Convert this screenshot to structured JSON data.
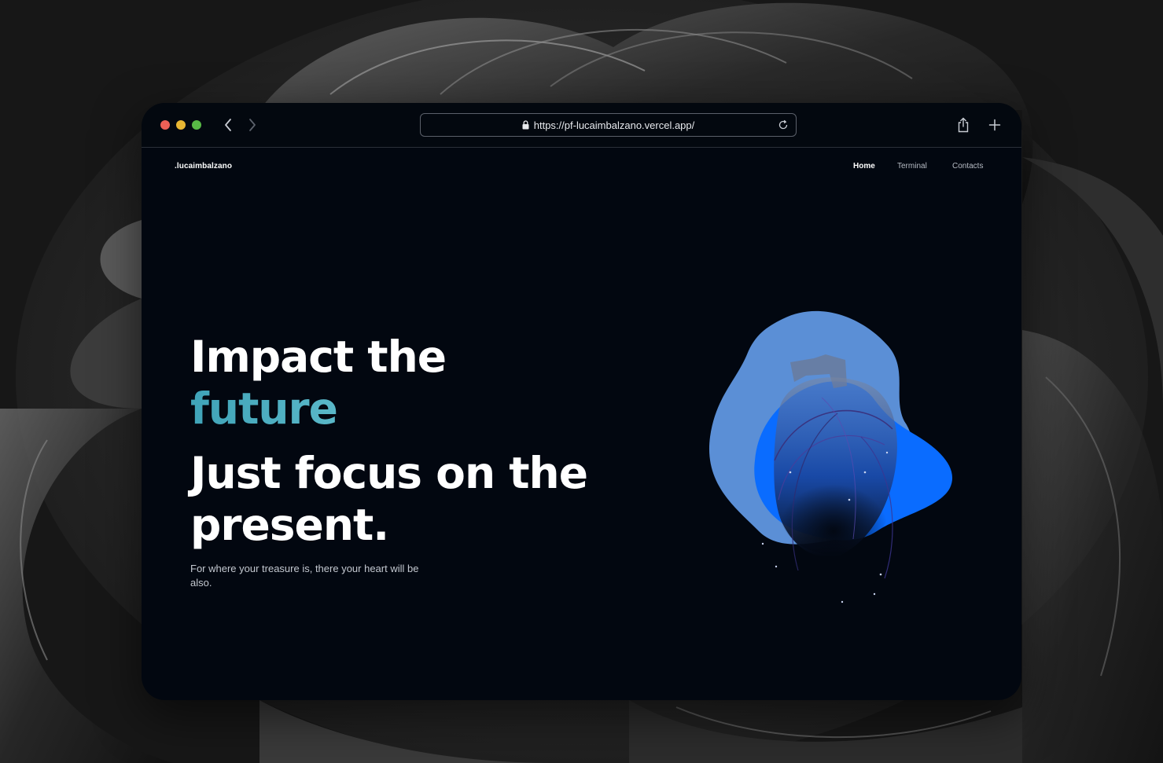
{
  "browser": {
    "url": "https://pf-lucaimbalzano.vercel.app/"
  },
  "site": {
    "logo": ".lucaimbalzano",
    "nav": [
      {
        "label": "Home"
      },
      {
        "label": "Terminal"
      },
      {
        "label": "Contacts"
      }
    ]
  },
  "hero": {
    "line1": "Impact the",
    "line2": "future",
    "line3": "Just focus on the",
    "line4": "present.",
    "subtitle": "For where your treasure is, there your heart will be also."
  },
  "colors": {
    "page_bg": "#020710",
    "accent_gradient_start": "#3fa3b8",
    "accent_gradient_end": "#8fe0e8",
    "blob_light": "#5b8fd6",
    "blob_bright": "#0a6cff"
  },
  "icons": {
    "back": "chevron-left-icon",
    "forward": "chevron-right-icon",
    "lock": "lock-icon",
    "reload": "reload-icon",
    "share": "share-icon",
    "new_tab": "plus-icon"
  }
}
